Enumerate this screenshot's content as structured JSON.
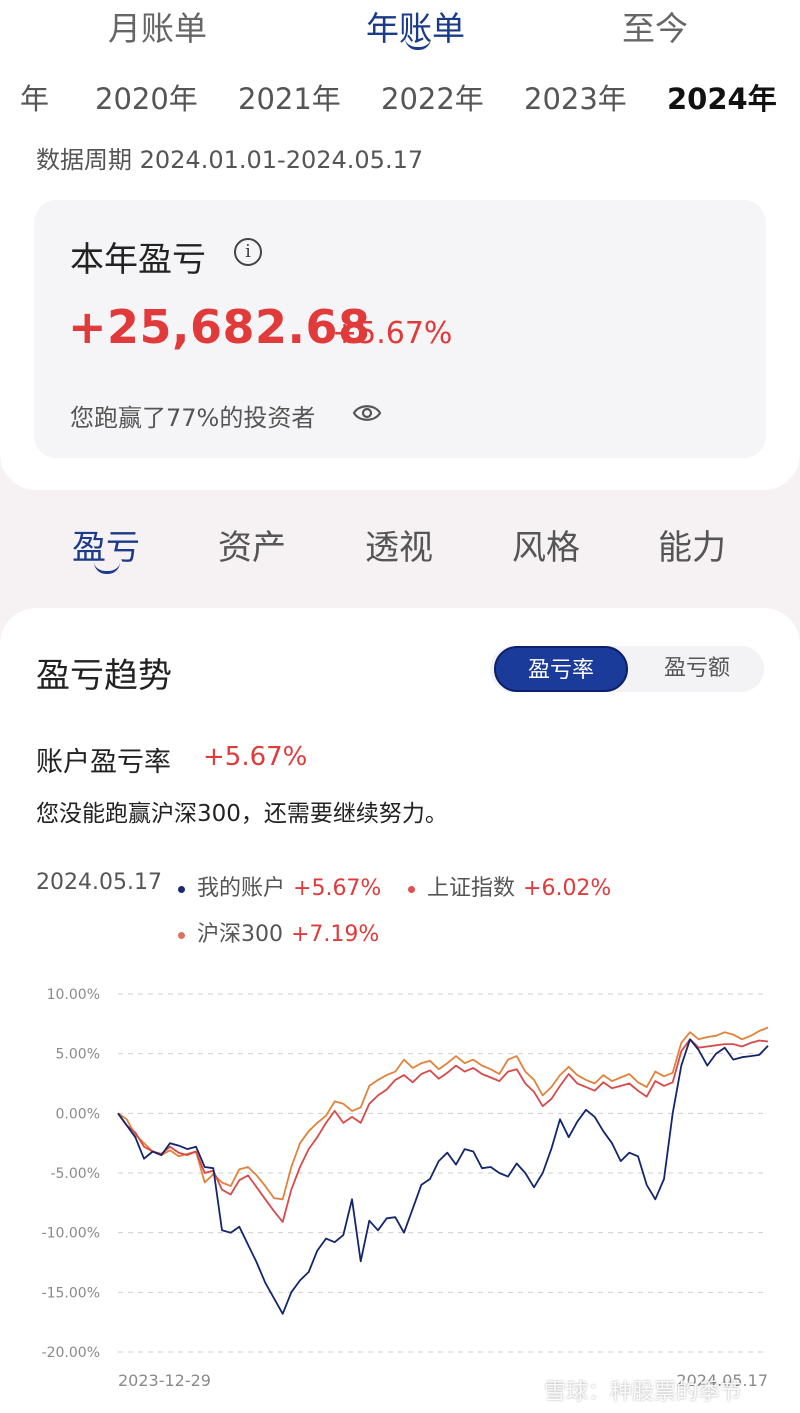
{
  "period_tabs": [
    {
      "label": "月账单",
      "active": false
    },
    {
      "label": "年账单",
      "active": true
    },
    {
      "label": "至今",
      "active": false
    }
  ],
  "years": [
    {
      "label": "年",
      "active": false
    },
    {
      "label": "2020年",
      "active": false
    },
    {
      "label": "2021年",
      "active": false
    },
    {
      "label": "2022年",
      "active": false
    },
    {
      "label": "2023年",
      "active": false
    },
    {
      "label": "2024年",
      "active": true
    }
  ],
  "data_period": "数据周期 2024.01.01-2024.05.17",
  "summary": {
    "title": "本年盈亏",
    "info_icon": "info-icon",
    "amount": "+25,682.68",
    "percent": "+5.67%",
    "beat_text": "您跑赢了77%的投资者",
    "eye_icon": "eye-icon"
  },
  "main_tabs": [
    {
      "label": "盈亏",
      "active": true
    },
    {
      "label": "资产",
      "active": false
    },
    {
      "label": "透视",
      "active": false
    },
    {
      "label": "风格",
      "active": false
    },
    {
      "label": "能力",
      "active": false
    }
  ],
  "trend": {
    "title": "盈亏趋势",
    "toggle_rate": "盈亏率",
    "toggle_amount": "盈亏额",
    "account_rate_label": "账户盈亏率",
    "account_rate_value": "+5.67%",
    "verdict": "您没能跑赢沪深300，还需要继续努力。",
    "legend_date": "2024.05.17",
    "legend": [
      {
        "name": "我的账户",
        "value": "+5.67%",
        "color": "#1a2a6c"
      },
      {
        "name": "上证指数",
        "value": "+6.02%",
        "color": "#e05050"
      },
      {
        "name": "沪深300",
        "value": "+7.19%",
        "color": "#e07060"
      }
    ]
  },
  "chart_data": {
    "type": "line",
    "x_start_label": "2023-12-29",
    "x_end_label": "2024.05.17",
    "yticks": [
      "10.00%",
      "5.00%",
      "0.00%",
      "-5.00%",
      "-10.00%",
      "-15.00%",
      "-20.00%"
    ],
    "ylim": [
      -20,
      10
    ],
    "grid": true,
    "series": [
      {
        "name": "我的账户",
        "color": "#14266b",
        "values": [
          0,
          -1,
          -2,
          -3.8,
          -3.2,
          -3.5,
          -2.5,
          -2.7,
          -3,
          -2.8,
          -4.5,
          -4.6,
          -9.8,
          -10,
          -9.5,
          -11,
          -12.5,
          -14.2,
          -15.5,
          -16.8,
          -15,
          -14,
          -13.3,
          -11.5,
          -10.5,
          -10.8,
          -10.2,
          -7.2,
          -12.4,
          -9,
          -9.8,
          -8.8,
          -8.7,
          -10,
          -8,
          -6,
          -5.5,
          -4,
          -3.3,
          -4.3,
          -3,
          -3.2,
          -4.6,
          -4.5,
          -5,
          -5.3,
          -4.2,
          -5,
          -6.2,
          -5,
          -3,
          -0.5,
          -2,
          -0.7,
          0.3,
          -0.3,
          -1.5,
          -2.5,
          -4,
          -3.3,
          -3.6,
          -6,
          -7.2,
          -5.5,
          0,
          4,
          6.2,
          5.3,
          4,
          5,
          5.5,
          4.5,
          4.7,
          4.8,
          4.9,
          5.67
        ]
      },
      {
        "name": "上证指数",
        "color": "#d84a4a",
        "values": [
          0,
          -1,
          -1.6,
          -2.8,
          -3.2,
          -3.4,
          -2.8,
          -3.3,
          -3.5,
          -3.2,
          -5,
          -4.8,
          -6.4,
          -6.8,
          -5.6,
          -5.2,
          -6.2,
          -7.2,
          -8.2,
          -9.1,
          -6.4,
          -4.5,
          -3,
          -2,
          -0.8,
          0.2,
          -0.8,
          -0.3,
          -0.8,
          0.8,
          1.5,
          2,
          2.8,
          3.2,
          2.6,
          3.3,
          3.6,
          2.9,
          3.4,
          4,
          3.5,
          3.8,
          3.3,
          3,
          2.7,
          3.5,
          3.7,
          2.5,
          1.8,
          0.6,
          1.2,
          2.3,
          3.3,
          2.5,
          2.2,
          1.9,
          2.6,
          2.1,
          2.3,
          2.5,
          1.9,
          1.4,
          2.7,
          2.3,
          2.6,
          5.2,
          6.2,
          5.5,
          5.6,
          5.7,
          5.8,
          5.8,
          5.6,
          5.9,
          6.1,
          6.02
        ]
      },
      {
        "name": "沪深300",
        "color": "#e0823a",
        "values": [
          0,
          -0.5,
          -1.8,
          -2.5,
          -3.2,
          -3.5,
          -3.1,
          -3.6,
          -3.4,
          -3.2,
          -5.8,
          -5.1,
          -5.8,
          -6.1,
          -4.7,
          -4.5,
          -5.2,
          -6.1,
          -7.1,
          -7.2,
          -4.5,
          -2.5,
          -1.5,
          -0.8,
          -0.2,
          1,
          0.8,
          0.2,
          0.5,
          2.3,
          2.8,
          3.2,
          3.5,
          4.5,
          3.8,
          4.2,
          4.4,
          3.7,
          4.2,
          4.8,
          4.2,
          4.5,
          4,
          3.7,
          3.3,
          4.5,
          4.8,
          3.5,
          2.8,
          1.5,
          2.2,
          3.2,
          3.9,
          3.2,
          2.8,
          2.5,
          3.2,
          2.7,
          3,
          3.3,
          2.6,
          2.2,
          3.5,
          3.1,
          3.4,
          5.9,
          6.8,
          6.2,
          6.4,
          6.5,
          6.8,
          6.6,
          6.2,
          6.5,
          6.9,
          7.19
        ]
      }
    ]
  },
  "watermark": "雪球：种股票的季节"
}
